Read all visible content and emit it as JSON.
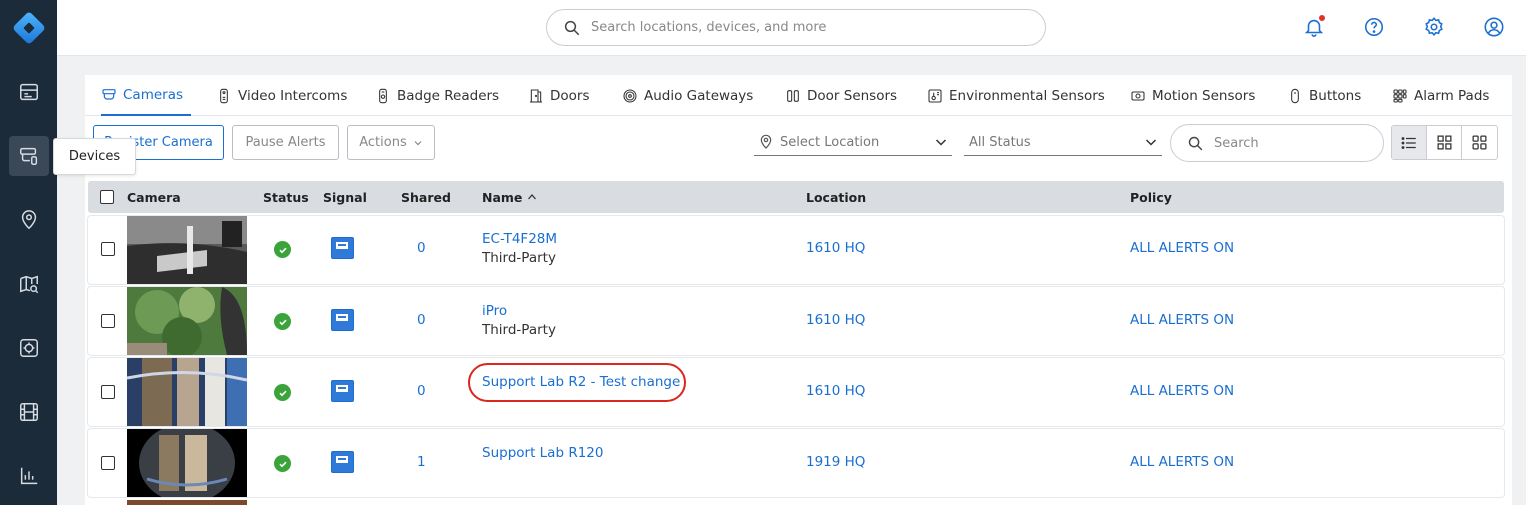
{
  "sidebar": {
    "tooltip": "Devices",
    "items": [
      {
        "icon": "dashboard-icon"
      },
      {
        "icon": "devices-icon",
        "active": true
      },
      {
        "icon": "location-pin-icon"
      },
      {
        "icon": "map-search-icon"
      },
      {
        "icon": "access-icon"
      },
      {
        "icon": "film-icon"
      },
      {
        "icon": "analytics-icon"
      }
    ]
  },
  "topbar": {
    "search_placeholder": "Search locations, devices, and more"
  },
  "tabs": [
    {
      "label": "Cameras",
      "active": true
    },
    {
      "label": "Video Intercoms"
    },
    {
      "label": "Badge Readers"
    },
    {
      "label": "Doors"
    },
    {
      "label": "Audio Gateways"
    },
    {
      "label": "Door Sensors"
    },
    {
      "label": "Environmental Sensors"
    },
    {
      "label": "Motion Sensors"
    },
    {
      "label": "Buttons"
    },
    {
      "label": "Alarm Pads"
    }
  ],
  "toolbar": {
    "register_label": "Register Camera",
    "pause_label": "Pause Alerts",
    "actions_label": "Actions",
    "location_placeholder": "Select Location",
    "status_value": "All Status",
    "search_placeholder": "Search"
  },
  "table": {
    "headers": {
      "camera": "Camera",
      "status": "Status",
      "signal": "Signal",
      "shared": "Shared",
      "name": "Name",
      "location": "Location",
      "policy": "Policy"
    },
    "rows": [
      {
        "shared": "0",
        "name": "EC-T4F28M",
        "subtitle": "Third-Party",
        "location": "1610 HQ",
        "policy": "ALL ALERTS ON"
      },
      {
        "shared": "0",
        "name": "iPro",
        "subtitle": "Third-Party",
        "location": "1610 HQ",
        "policy": "ALL ALERTS ON"
      },
      {
        "shared": "0",
        "name": "Support Lab R2 - Test change",
        "subtitle": "",
        "location": "1610 HQ",
        "policy": "ALL ALERTS ON"
      },
      {
        "shared": "1",
        "name": "Support Lab R120",
        "subtitle": "",
        "location": "1919 HQ",
        "policy": "ALL ALERTS ON"
      }
    ]
  },
  "colors": {
    "accent": "#1a6fd1",
    "sidebar": "#1c2b3a",
    "status_ok": "#3aa43a",
    "highlight": "#d8281f"
  }
}
